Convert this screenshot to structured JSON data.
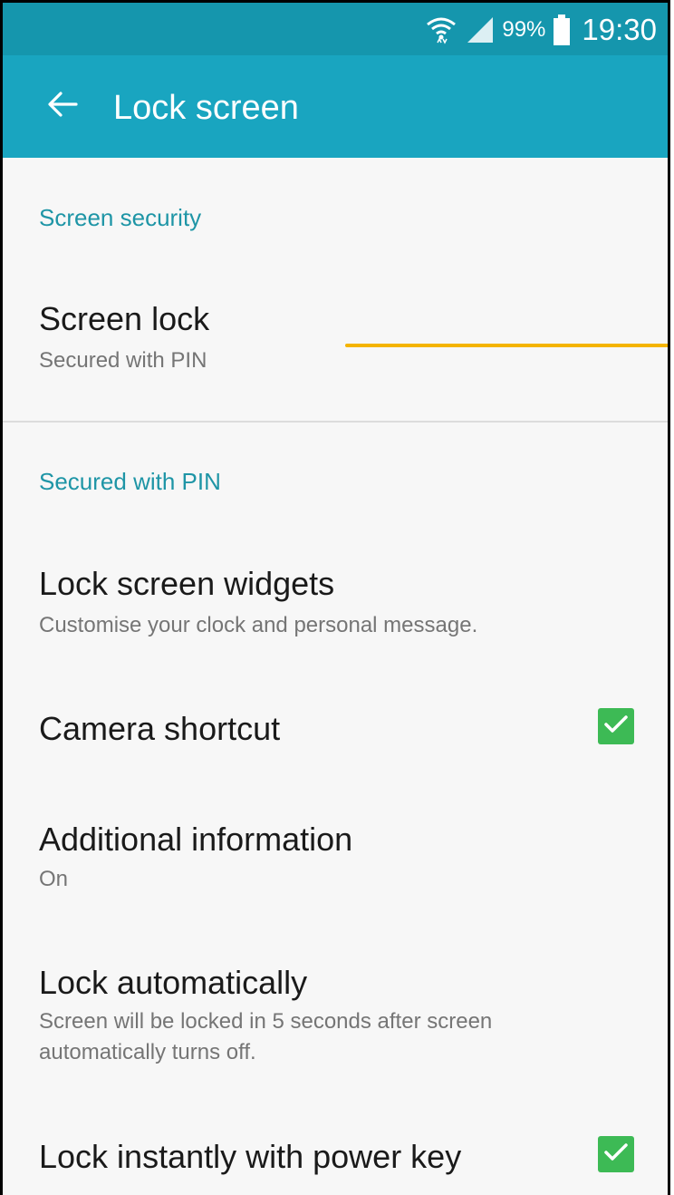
{
  "status_bar": {
    "battery_percent": "99%",
    "time": "19:30",
    "icons": [
      "wifi-icon",
      "signal-icon",
      "battery-icon"
    ]
  },
  "app_bar": {
    "title": "Lock screen",
    "back_icon": "back-arrow-icon"
  },
  "sections": {
    "screen_security": {
      "header": "Screen security"
    },
    "secured_with_pin": {
      "header": "Secured with PIN"
    }
  },
  "items": {
    "screen_lock": {
      "title": "Screen lock",
      "subtitle": "Secured with PIN"
    },
    "lock_screen_widgets": {
      "title": "Lock screen widgets",
      "subtitle": "Customise your clock and personal message."
    },
    "camera_shortcut": {
      "title": "Camera shortcut",
      "checked": true
    },
    "additional_information": {
      "title": "Additional information",
      "subtitle": "On"
    },
    "lock_automatically": {
      "title": "Lock automatically",
      "subtitle": "Screen will be locked in 5 seconds after screen automatically turns off."
    },
    "lock_instantly": {
      "title": "Lock instantly with power key",
      "checked": true
    }
  },
  "colors": {
    "status_bar": "#1596ad",
    "app_bar": "#19a5c0",
    "section_header": "#1e95a6",
    "checkbox": "#3dba55",
    "annotation_line": "#f4b400",
    "background": "#f7f7f7"
  }
}
